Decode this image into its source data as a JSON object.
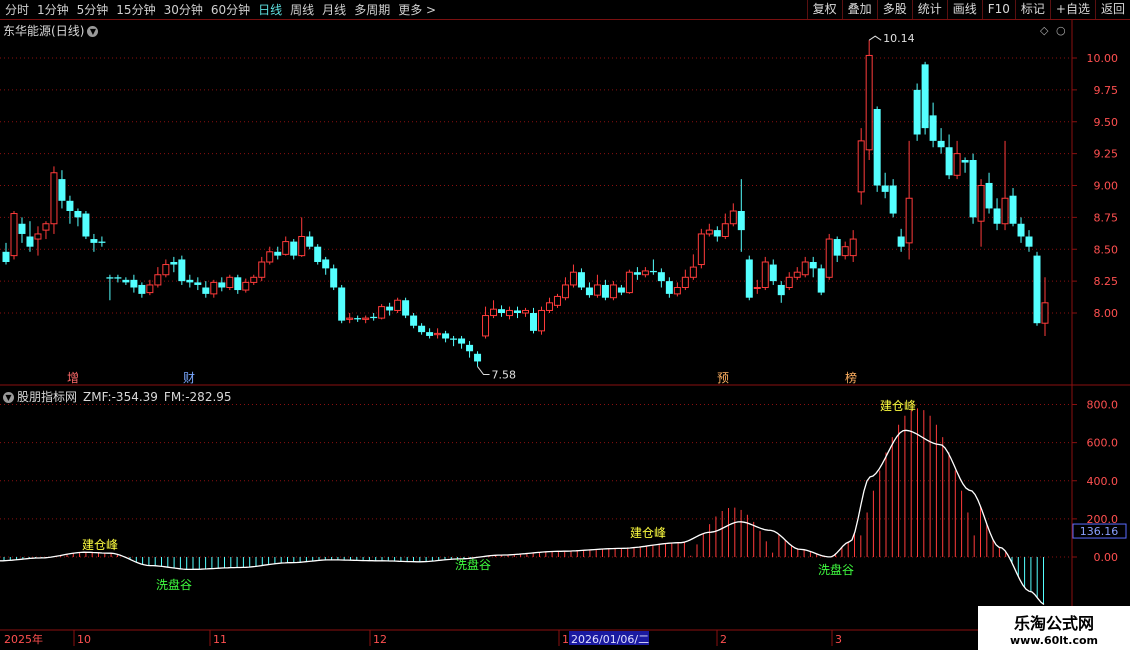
{
  "toolbar": {
    "periods": [
      "分时",
      "1分钟",
      "5分钟",
      "15分钟",
      "30分钟",
      "60分钟",
      "日线",
      "周线",
      "月线",
      "多周期",
      "更多"
    ],
    "active_period": "日线",
    "more_arrow": ">",
    "buttons": [
      "复权",
      "叠加",
      "多股",
      "统计",
      "画线",
      "F10",
      "标记",
      "+自选",
      "返回"
    ]
  },
  "main_chart": {
    "stock_name": "东华能源",
    "period_label": "(日线)",
    "high_label": "10.14",
    "low_label": "7.58",
    "price_ticks": [
      "10.00",
      "9.75",
      "9.50",
      "9.25",
      "9.00",
      "8.75",
      "8.50",
      "8.25",
      "8.00"
    ],
    "markers": [
      "增",
      "财",
      "预",
      "榜"
    ]
  },
  "indicator": {
    "name": "股朋指标网",
    "zmf_label": "ZMF:-354.39",
    "fm_label": "FM:-282.95",
    "ticks": [
      "800.0",
      "600.0",
      "400.0",
      "200.0",
      "0.00"
    ],
    "current_value": "136.16",
    "annotations": {
      "peak": "建仓峰",
      "valley": "洗盘谷"
    }
  },
  "time_axis": {
    "year_label": "2025年",
    "months": [
      "10",
      "11",
      "12",
      "1",
      "2",
      "3"
    ],
    "cursor_date": "2026/01/06/二"
  },
  "watermark": {
    "line1": "乐淘公式网",
    "line2": "www.60lt.com"
  },
  "colors": {
    "up": "#ff3b3b",
    "down": "#54ffff",
    "grid": "#8a1010",
    "curve": "#ffffff"
  },
  "chart_data": {
    "type": "candlestick",
    "ylim": [
      7.4,
      10.25
    ],
    "candles": [
      [
        8.48,
        8.4,
        8.55,
        8.38
      ],
      [
        8.45,
        8.78,
        8.8,
        8.42
      ],
      [
        8.7,
        8.62,
        8.75,
        8.55
      ],
      [
        8.6,
        8.52,
        8.72,
        8.48
      ],
      [
        8.58,
        8.62,
        8.68,
        8.45
      ],
      [
        8.65,
        8.7,
        8.72,
        8.58
      ],
      [
        8.7,
        9.1,
        9.15,
        8.62
      ],
      [
        9.05,
        8.88,
        9.12,
        8.82
      ],
      [
        8.88,
        8.8,
        8.92,
        8.7
      ],
      [
        8.8,
        8.75,
        8.82,
        8.68
      ],
      [
        8.78,
        8.6,
        8.8,
        8.58
      ],
      [
        8.58,
        8.55,
        8.62,
        8.48
      ],
      [
        8.56,
        8.55,
        8.6,
        8.52
      ],
      [
        8.28,
        8.27,
        8.3,
        8.1
      ],
      [
        8.28,
        8.27,
        8.3,
        8.24
      ],
      [
        8.26,
        8.24,
        8.28,
        8.22
      ],
      [
        8.26,
        8.2,
        8.3,
        8.16
      ],
      [
        8.22,
        8.15,
        8.24,
        8.12
      ],
      [
        8.16,
        8.22,
        8.26,
        8.14
      ],
      [
        8.22,
        8.3,
        8.36,
        8.2
      ],
      [
        8.3,
        8.38,
        8.42,
        8.28
      ],
      [
        8.4,
        8.38,
        8.44,
        8.32
      ],
      [
        8.42,
        8.25,
        8.45,
        8.22
      ],
      [
        8.26,
        8.24,
        8.3,
        8.2
      ],
      [
        8.24,
        8.22,
        8.28,
        8.18
      ],
      [
        8.2,
        8.15,
        8.25,
        8.12
      ],
      [
        8.15,
        8.24,
        8.26,
        8.12
      ],
      [
        8.24,
        8.2,
        8.28,
        8.17
      ],
      [
        8.2,
        8.28,
        8.3,
        8.18
      ],
      [
        8.28,
        8.18,
        8.3,
        8.15
      ],
      [
        8.18,
        8.24,
        8.27,
        8.16
      ],
      [
        8.24,
        8.28,
        8.3,
        8.22
      ],
      [
        8.28,
        8.4,
        8.44,
        8.25
      ],
      [
        8.4,
        8.48,
        8.52,
        8.38
      ],
      [
        8.48,
        8.45,
        8.52,
        8.42
      ],
      [
        8.46,
        8.56,
        8.6,
        8.45
      ],
      [
        8.56,
        8.45,
        8.58,
        8.42
      ],
      [
        8.45,
        8.6,
        8.75,
        8.44
      ],
      [
        8.6,
        8.52,
        8.64,
        8.5
      ],
      [
        8.52,
        8.4,
        8.54,
        8.38
      ],
      [
        8.42,
        8.35,
        8.44,
        8.3
      ],
      [
        8.35,
        8.2,
        8.38,
        8.18
      ],
      [
        8.2,
        7.94,
        8.22,
        7.92
      ],
      [
        7.95,
        7.96,
        8.0,
        7.92
      ],
      [
        7.96,
        7.95,
        7.98,
        7.93
      ],
      [
        7.95,
        7.96,
        7.98,
        7.92
      ],
      [
        7.97,
        7.96,
        8.0,
        7.94
      ],
      [
        7.96,
        8.05,
        8.07,
        7.95
      ],
      [
        8.05,
        8.02,
        8.08,
        7.98
      ],
      [
        8.02,
        8.1,
        8.12,
        8.0
      ],
      [
        8.1,
        7.98,
        8.12,
        7.96
      ],
      [
        7.98,
        7.9,
        8.0,
        7.88
      ],
      [
        7.9,
        7.85,
        7.92,
        7.83
      ],
      [
        7.85,
        7.82,
        7.88,
        7.8
      ],
      [
        7.83,
        7.84,
        7.88,
        7.8
      ],
      [
        7.84,
        7.8,
        7.86,
        7.77
      ],
      [
        7.8,
        7.79,
        7.82,
        7.74
      ],
      [
        7.8,
        7.76,
        7.82,
        7.72
      ],
      [
        7.75,
        7.7,
        7.78,
        7.65
      ],
      [
        7.68,
        7.62,
        7.7,
        7.58
      ],
      [
        7.82,
        7.98,
        8.05,
        7.8
      ],
      [
        7.98,
        8.03,
        8.1,
        7.96
      ],
      [
        8.03,
        8.0,
        8.06,
        7.97
      ],
      [
        7.98,
        8.02,
        8.05,
        7.95
      ],
      [
        8.02,
        8.0,
        8.05,
        7.96
      ],
      [
        8.0,
        8.02,
        8.04,
        7.97
      ],
      [
        8.0,
        7.86,
        8.04,
        7.84
      ],
      [
        7.86,
        8.02,
        8.05,
        7.83
      ],
      [
        8.02,
        8.08,
        8.12,
        8.0
      ],
      [
        8.06,
        8.13,
        8.15,
        8.04
      ],
      [
        8.12,
        8.22,
        8.28,
        8.1
      ],
      [
        8.22,
        8.32,
        8.38,
        8.2
      ],
      [
        8.32,
        8.2,
        8.35,
        8.18
      ],
      [
        8.2,
        8.14,
        8.24,
        8.12
      ],
      [
        8.14,
        8.22,
        8.3,
        8.12
      ],
      [
        8.22,
        8.12,
        8.26,
        8.1
      ],
      [
        8.12,
        8.22,
        8.25,
        8.1
      ],
      [
        8.2,
        8.16,
        8.22,
        8.14
      ],
      [
        8.16,
        8.32,
        8.34,
        8.15
      ],
      [
        8.32,
        8.3,
        8.36,
        8.26
      ],
      [
        8.3,
        8.33,
        8.36,
        8.28
      ],
      [
        8.33,
        8.32,
        8.42,
        8.3
      ],
      [
        8.32,
        8.25,
        8.35,
        8.2
      ],
      [
        8.25,
        8.15,
        8.28,
        8.12
      ],
      [
        8.15,
        8.2,
        8.24,
        8.13
      ],
      [
        8.2,
        8.28,
        8.34,
        8.18
      ],
      [
        8.28,
        8.36,
        8.46,
        8.26
      ],
      [
        8.38,
        8.62,
        8.66,
        8.35
      ],
      [
        8.62,
        8.65,
        8.7,
        8.6
      ],
      [
        8.65,
        8.6,
        8.68,
        8.56
      ],
      [
        8.6,
        8.7,
        8.78,
        8.58
      ],
      [
        8.7,
        8.8,
        8.86,
        8.68
      ],
      [
        8.8,
        8.65,
        9.05,
        8.48
      ],
      [
        8.42,
        8.12,
        8.45,
        8.1
      ],
      [
        8.2,
        8.2,
        8.26,
        8.15
      ],
      [
        8.2,
        8.4,
        8.44,
        8.18
      ],
      [
        8.38,
        8.25,
        8.42,
        8.22
      ],
      [
        8.22,
        8.14,
        8.25,
        8.08
      ],
      [
        8.2,
        8.28,
        8.32,
        8.18
      ],
      [
        8.28,
        8.32,
        8.36,
        8.26
      ],
      [
        8.3,
        8.4,
        8.44,
        8.28
      ],
      [
        8.4,
        8.35,
        8.44,
        8.28
      ],
      [
        8.35,
        8.16,
        8.38,
        8.14
      ],
      [
        8.28,
        8.58,
        8.62,
        8.26
      ],
      [
        8.58,
        8.45,
        8.6,
        8.4
      ],
      [
        8.45,
        8.52,
        8.56,
        8.42
      ],
      [
        8.45,
        8.58,
        8.65,
        8.4
      ],
      [
        8.95,
        9.35,
        9.45,
        8.85
      ],
      [
        9.28,
        10.02,
        10.14,
        9.2
      ],
      [
        9.6,
        9.0,
        9.62,
        8.95
      ],
      [
        9.0,
        8.95,
        9.1,
        8.9
      ],
      [
        9.0,
        8.78,
        9.05,
        8.75
      ],
      [
        8.6,
        8.52,
        8.66,
        8.48
      ],
      [
        8.55,
        8.9,
        9.35,
        8.42
      ],
      [
        9.75,
        9.4,
        9.8,
        9.35
      ],
      [
        9.95,
        9.45,
        9.97,
        9.4
      ],
      [
        9.55,
        9.35,
        9.65,
        9.3
      ],
      [
        9.35,
        9.3,
        9.45,
        9.25
      ],
      [
        9.3,
        9.08,
        9.4,
        9.05
      ],
      [
        9.08,
        9.25,
        9.35,
        9.05
      ],
      [
        9.2,
        9.18,
        9.22,
        9.1
      ],
      [
        9.2,
        8.75,
        9.25,
        8.7
      ],
      [
        8.72,
        9.0,
        9.05,
        8.52
      ],
      [
        9.02,
        8.82,
        9.1,
        8.78
      ],
      [
        8.82,
        8.7,
        8.9,
        8.65
      ],
      [
        8.7,
        8.9,
        9.35,
        8.65
      ],
      [
        8.92,
        8.7,
        8.98,
        8.68
      ],
      [
        8.7,
        8.6,
        8.75,
        8.55
      ],
      [
        8.6,
        8.52,
        8.65,
        8.48
      ],
      [
        8.45,
        7.92,
        8.48,
        7.9
      ],
      [
        7.92,
        8.08,
        8.28,
        7.82
      ]
    ]
  }
}
